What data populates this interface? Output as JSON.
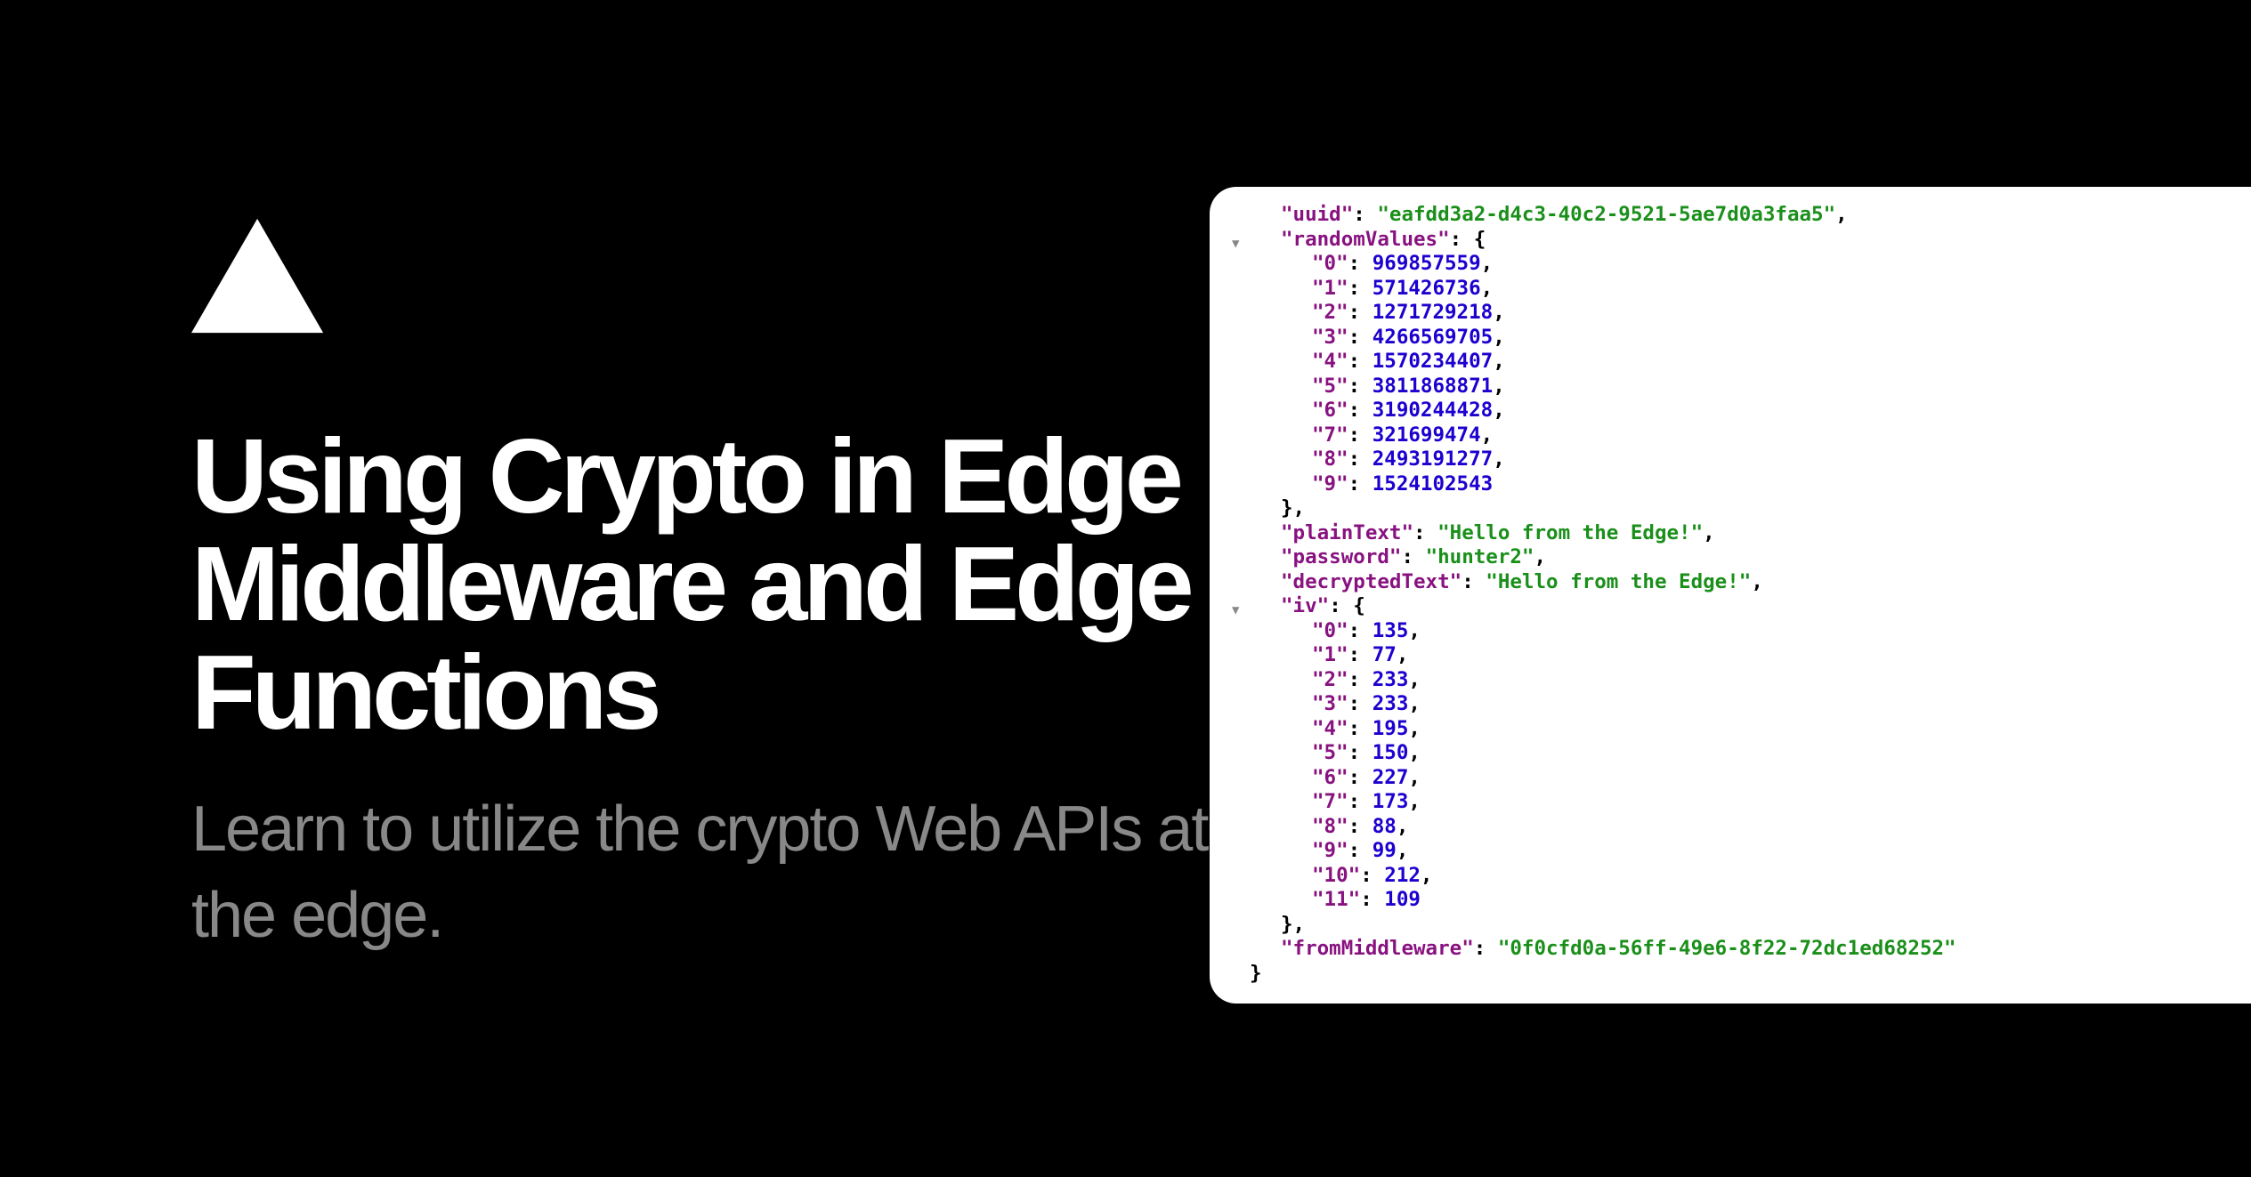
{
  "title": "Using Crypto in Edge Middleware and Edge Functions",
  "subtitle": "Learn to utilize the crypto Web APIs at the edge.",
  "code": {
    "uuid_key": "\"uuid\"",
    "uuid_value": "\"eafdd3a2-d4c3-40c2-9521-5ae7d0a3faa5\"",
    "randomValues_key": "\"randomValues\"",
    "rv": [
      {
        "k": "\"0\"",
        "v": "969857559"
      },
      {
        "k": "\"1\"",
        "v": "571426736"
      },
      {
        "k": "\"2\"",
        "v": "1271729218"
      },
      {
        "k": "\"3\"",
        "v": "4266569705"
      },
      {
        "k": "\"4\"",
        "v": "1570234407"
      },
      {
        "k": "\"5\"",
        "v": "3811868871"
      },
      {
        "k": "\"6\"",
        "v": "3190244428"
      },
      {
        "k": "\"7\"",
        "v": "321699474"
      },
      {
        "k": "\"8\"",
        "v": "2493191277"
      },
      {
        "k": "\"9\"",
        "v": "1524102543"
      }
    ],
    "plainText_key": "\"plainText\"",
    "plainText_value": "\"Hello from the Edge!\"",
    "password_key": "\"password\"",
    "password_value": "\"hunter2\"",
    "decryptedText_key": "\"decryptedText\"",
    "decryptedText_value": "\"Hello from the Edge!\"",
    "iv_key": "\"iv\"",
    "iv": [
      {
        "k": "\"0\"",
        "v": "135"
      },
      {
        "k": "\"1\"",
        "v": "77"
      },
      {
        "k": "\"2\"",
        "v": "233"
      },
      {
        "k": "\"3\"",
        "v": "233"
      },
      {
        "k": "\"4\"",
        "v": "195"
      },
      {
        "k": "\"5\"",
        "v": "150"
      },
      {
        "k": "\"6\"",
        "v": "227"
      },
      {
        "k": "\"7\"",
        "v": "173"
      },
      {
        "k": "\"8\"",
        "v": "88"
      },
      {
        "k": "\"9\"",
        "v": "99"
      },
      {
        "k": "\"10\"",
        "v": "212"
      },
      {
        "k": "\"11\"",
        "v": "109"
      }
    ],
    "fromMiddleware_key": "\"fromMiddleware\"",
    "fromMiddleware_value": "\"0f0cfd0a-56ff-49e6-8f22-72dc1ed68252\""
  }
}
